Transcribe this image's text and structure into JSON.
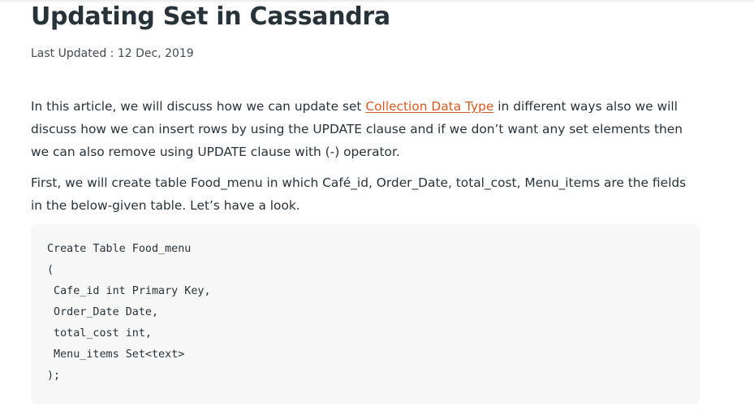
{
  "article": {
    "title": "Updating Set in Cassandra",
    "last_updated": "Last Updated : 12 Dec, 2019",
    "paragraphs": [
      {
        "before_link": "In this article, we will discuss how we can update set ",
        "link_text": "Collection Data Type",
        "after_link": " in different ways also we will discuss how we can insert rows by using the UPDATE clause and if we don’t want any set elements then we can also remove using UPDATE clause with (-) operator."
      },
      {
        "text": "First, we will create table Food_menu in which Café_id, Order_Date, total_cost, Menu_items are the fields in the below-given table. Let’s have a look."
      }
    ],
    "code_lines": [
      "Create Table Food_menu",
      "(",
      " Cafe_id int Primary Key,",
      " Order_Date Date,",
      " total_cost int,",
      " Menu_items Set<text>",
      ");"
    ]
  },
  "colors": {
    "text": "#273239",
    "link": "#d95a21",
    "code_background": "#f7f7f7"
  }
}
